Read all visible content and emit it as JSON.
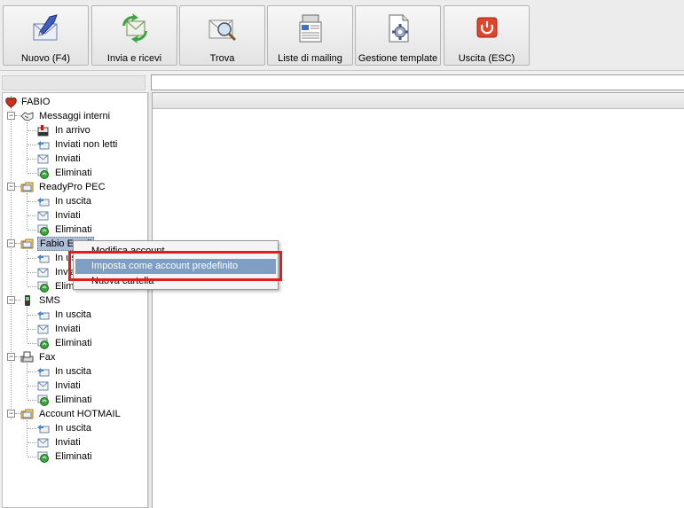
{
  "toolbar": {
    "buttons": [
      {
        "label": "Nuovo (F4)",
        "icon": "pen-envelope-icon"
      },
      {
        "label": "Invia e ricevi",
        "icon": "send-receive-icon"
      },
      {
        "label": "Trova",
        "icon": "magnifier-envelope-icon"
      },
      {
        "label": "Liste di mailing",
        "icon": "mailing-list-icon"
      },
      {
        "label": "Gestione template",
        "icon": "template-gear-icon"
      },
      {
        "label": "Uscita (ESC)",
        "icon": "power-icon"
      }
    ]
  },
  "tree": {
    "root": "FABIO",
    "groups": [
      {
        "label": "Messaggi interni",
        "children": [
          "In arrivo",
          "Inviati non letti",
          "Inviati",
          "Eliminati"
        ]
      },
      {
        "label": "ReadyPro PEC",
        "children": [
          "In uscita",
          "Inviati",
          "Eliminati"
        ]
      },
      {
        "label": "Fabio Email",
        "children": [
          "In uscita",
          "Inviati",
          "Eliminati"
        ]
      },
      {
        "label": "SMS",
        "children": [
          "In uscita",
          "Inviati",
          "Eliminati"
        ]
      },
      {
        "label": "Fax",
        "children": [
          "In uscita",
          "Inviati",
          "Eliminati"
        ]
      },
      {
        "label": "Account HOTMAIL",
        "children": [
          "In uscita",
          "Inviati",
          "Eliminati"
        ]
      }
    ]
  },
  "context_menu": {
    "items": [
      "Modifica account",
      "Imposta come account predefinito",
      "Nuova cartella"
    ],
    "highlighted": 1
  },
  "colors": {
    "highlight": "#7f9ec4",
    "annotation_box": "#e31d1d",
    "selection": "#aebed6"
  }
}
